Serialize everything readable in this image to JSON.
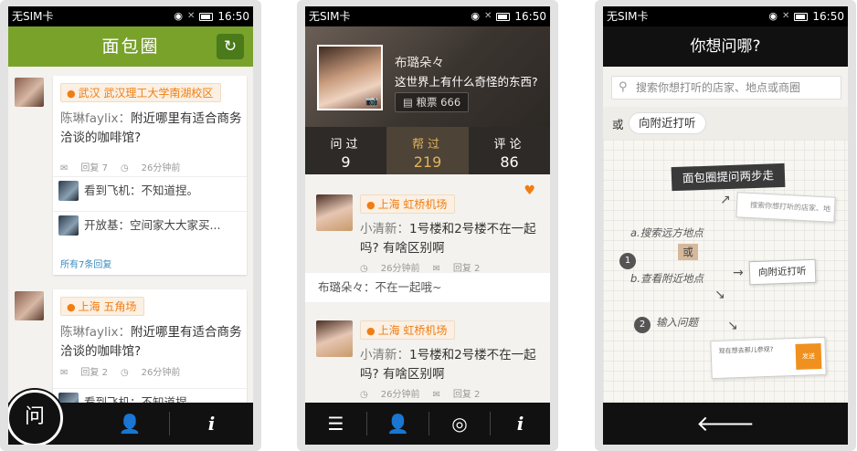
{
  "status": {
    "carrier": "无SIM卡",
    "time": "16:50"
  },
  "screen1": {
    "title": "面包圈",
    "feed": [
      {
        "location": "武汉 武汉理工大学南湖校区",
        "author": "陈琳faylix：",
        "question": "附近哪里有适合商务洽谈的咖啡馆?",
        "replies_count": "回复 7",
        "time": "26分钟前",
        "replies": [
          {
            "author": "看到飞机：",
            "text": "不知道捏。"
          },
          {
            "author": "开放基：",
            "text": "空间家大大家买..."
          }
        ],
        "more": "所有7条回复"
      },
      {
        "location": "上海 五角场",
        "author": "陈琳faylix：",
        "question": "附近哪里有适合商务洽谈的咖啡馆?",
        "replies_count": "回复 2",
        "time": "26分钟前",
        "replies": [
          {
            "author": "看到飞机：",
            "text": "不知道捏。"
          }
        ]
      }
    ],
    "fab_label": "问",
    "tab_info": "i"
  },
  "screen2": {
    "name": "布璐朵々",
    "bio": "这世界上有什么奇怪的东西?",
    "coins": "粮票 666",
    "stats": [
      {
        "label": "问过",
        "value": "9"
      },
      {
        "label": "帮过",
        "value": "219"
      },
      {
        "label": "评论",
        "value": "86"
      }
    ],
    "posts": [
      {
        "location": "上海 虹桥机场",
        "author": "小清新：",
        "question": "1号楼和2号楼不在一起吗? 有啥区别啊",
        "time": "26分钟前",
        "replies_count": "回复 2"
      },
      {
        "location": "上海 虹桥机场",
        "author": "小清新：",
        "question": "1号楼和2号楼不在一起吗? 有啥区别啊",
        "time": "26分钟前",
        "replies_count": "回复 2"
      }
    ],
    "comment": "布璐朵々：不在一起哦~",
    "tab_info": "i"
  },
  "screen3": {
    "title": "你想问哪?",
    "search_placeholder": "搜索你想打听的店家、地点或商圈",
    "or": "或",
    "nearby": "向附近打听",
    "guide_title": "面包圈提问两步走",
    "guide_search": "搜索你想打听的店家、地",
    "step_a": "a.搜索远方地点",
    "step_or": "或",
    "step_b": "b.查看附近地点",
    "step_2": "输入问题",
    "guide_nearby": "向附近打听",
    "guide_ask_text": "现在想去那儿参观?",
    "guide_ask_btn": "发送",
    "circle_1": "1",
    "circle_2": "2"
  }
}
